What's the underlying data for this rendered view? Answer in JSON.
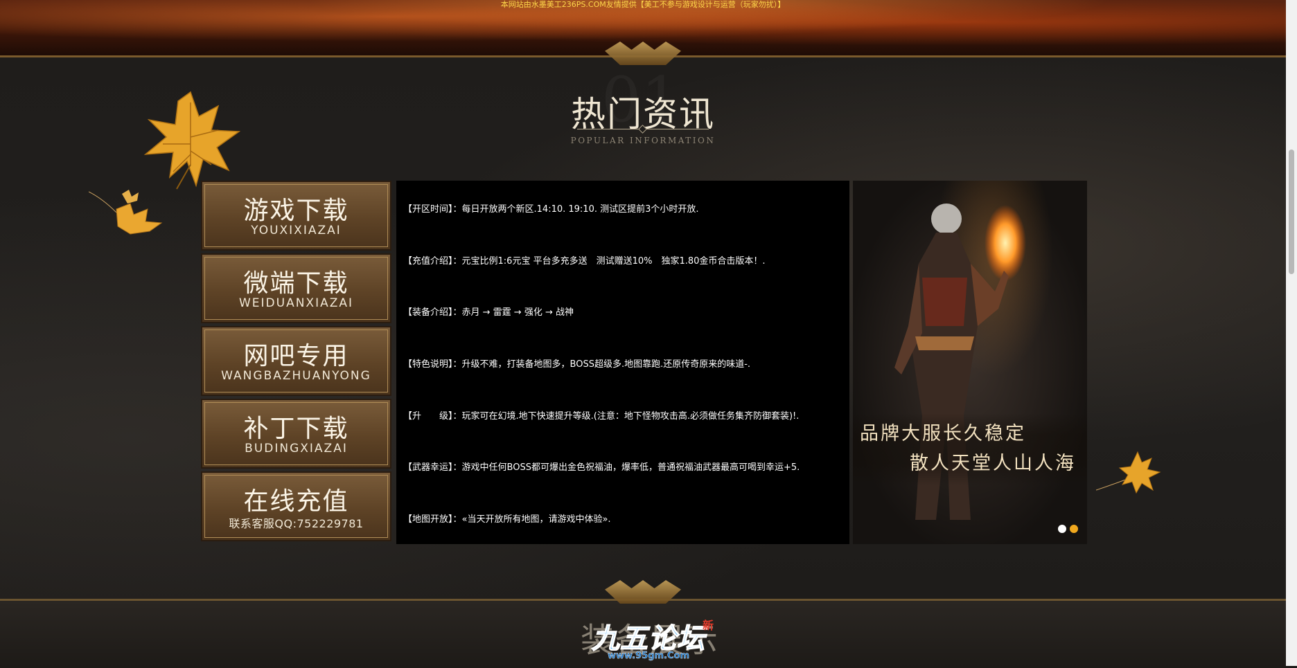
{
  "top_notice": "本网站由水墨美工236PS.COM友情提供【美工不参与游戏设计与运营（玩家勿扰）】",
  "section": {
    "number": "01",
    "title": "热门资讯",
    "subtitle": "POPULAR INFORMATION"
  },
  "menu": [
    {
      "title": "游戏下载",
      "sub": "YOUXIXIAZAI"
    },
    {
      "title": "微端下载",
      "sub": "WEIDUANXIAZAI"
    },
    {
      "title": "网吧专用",
      "sub": "WANGBAZHUANYONG"
    },
    {
      "title": "补丁下载",
      "sub": "BUDINGXIAZAI"
    },
    {
      "title": "在线充值",
      "sub": "联系客服QQ:752229781"
    }
  ],
  "info": [
    {
      "label": "【开区时间】：",
      "text": "每日开放两个新区.14:10. 19:10. 测试区提前3个小时开放."
    },
    {
      "label": "【充值介绍】：",
      "text": "元宝比例1:6元宝 平台多充多送　测试赠送10%　独家1.80金币合击版本！."
    },
    {
      "label": "【装备介绍】：",
      "text": "赤月 → 雷霆 → 强化 → 战神"
    },
    {
      "label": "【特色说明】：",
      "text": "升级不难，打装备地图多，BOSS超级多.地图靠跑.还原传奇原来的味道-."
    },
    {
      "label": "【升　　级】：",
      "text": "玩家可在幻境.地下快速提升等级.(注意：地下怪物攻击高.必须做任务集齐防御套装)!."
    },
    {
      "label": "【武器幸运】：",
      "text": "游戏中任何BOSS都可爆出金色祝福油，爆率低，普通祝福油武器最高可喝到幸运+5."
    },
    {
      "label": "【地图开放】：",
      "text": "«当天开放所有地图，请游戏中体验»."
    }
  ],
  "promo": {
    "line1": "品牌大服长久稳定",
    "line2": "散人天堂人山人海",
    "active_slide": 2,
    "slide_count": 2
  },
  "bottom": {
    "title": "装备展示",
    "logo_text": "九五论坛",
    "logo_url": "www.95gm.Com",
    "logo_badge": "新"
  },
  "colors": {
    "accent_gold": "#f0a81e",
    "button_brown": "#5e4326",
    "panel_black": "#000000"
  }
}
